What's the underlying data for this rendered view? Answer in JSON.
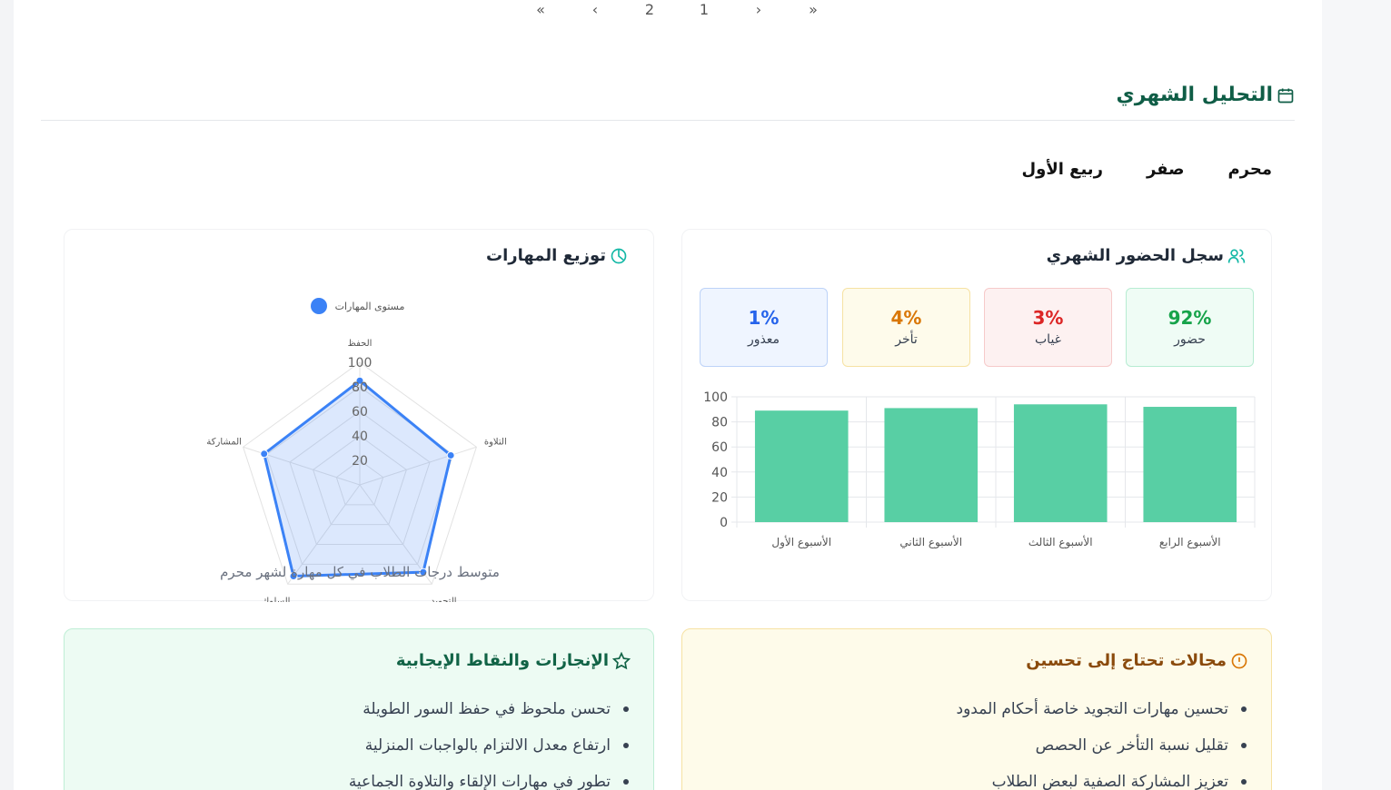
{
  "pagination": {
    "items": [
      "«",
      "‹",
      "2",
      "1",
      "›",
      "»"
    ]
  },
  "section": {
    "title": "التحليل الشهري"
  },
  "months": [
    "محرم",
    "صفر",
    "ربيع الأول"
  ],
  "attendance": {
    "title": "سجل الحضور الشهري",
    "stats": [
      {
        "value": "92%",
        "label": "حضور"
      },
      {
        "value": "3%",
        "label": "غياب"
      },
      {
        "value": "4%",
        "label": "تأخر"
      },
      {
        "value": "1%",
        "label": "معذور"
      }
    ],
    "colors": {
      "bar": "#58cfa4",
      "present": "#16a34a",
      "absent": "#dc2626",
      "late": "#d97706",
      "excused": "#2563eb"
    }
  },
  "skills": {
    "title": "توزيع المهارات",
    "caption": "متوسط درجات الطلاب في كل مهارة لشهر محرم",
    "colors": {
      "line": "#3b82f6",
      "fill": "rgba(59,130,246,0.18)"
    }
  },
  "achievements": {
    "title": "الإنجازات والنقاط الإيجابية",
    "items": [
      "تحسن ملحوظ في حفظ السور الطويلة",
      "ارتفاع معدل الالتزام بالواجبات المنزلية",
      "تطور في مهارات الإلقاء والتلاوة الجماعية"
    ]
  },
  "improvements": {
    "title": "مجالات تحتاج إلى تحسين",
    "items": [
      "تحسين مهارات التجويد خاصة أحكام المدود",
      "تقليل نسبة التأخر عن الحصص",
      "تعزيز المشاركة الصفية لبعض الطلاب"
    ]
  },
  "chart_data": [
    {
      "type": "bar",
      "categories": [
        "الأسبوع الأول",
        "الأسبوع الثاني",
        "الأسبوع الثالث",
        "الأسبوع الرابع"
      ],
      "values": [
        89,
        91,
        94,
        92
      ],
      "ylim": [
        0,
        100
      ],
      "yticks": [
        0,
        20,
        40,
        60,
        80,
        100
      ],
      "grid": true
    },
    {
      "type": "radar",
      "categories": [
        "الحفظ",
        "التلاوة",
        "التجويد",
        "السلوك",
        "المشاركة"
      ],
      "series": [
        {
          "name": "مستوى المهارات",
          "values": [
            85,
            78,
            88,
            92,
            82
          ]
        }
      ],
      "rlim": [
        0,
        100
      ],
      "rticks": [
        20,
        40,
        60,
        80,
        100
      ],
      "legend": "top"
    }
  ]
}
